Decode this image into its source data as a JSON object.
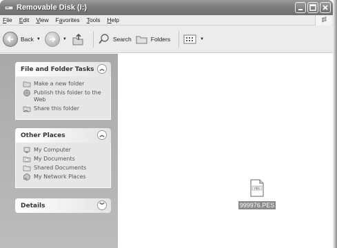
{
  "window": {
    "title": "Removable Disk (I:)"
  },
  "menu": {
    "items": [
      {
        "u": "F",
        "rest": "ile"
      },
      {
        "u": "E",
        "rest": "dit"
      },
      {
        "u": "V",
        "rest": "iew"
      },
      {
        "pre": "F",
        "u": "a",
        "rest": "vorites"
      },
      {
        "u": "T",
        "rest": "ools"
      },
      {
        "u": "H",
        "rest": "elp"
      }
    ]
  },
  "toolbar": {
    "back": "Back",
    "search": "Search",
    "folders": "Folders"
  },
  "sidepane": {
    "tasks": {
      "title": "File and Folder Tasks",
      "items": [
        "Make a new folder",
        "Publish this folder to the Web",
        "Share this folder"
      ]
    },
    "places": {
      "title": "Other Places",
      "items": [
        "My Computer",
        "My Documents",
        "Shared Documents",
        "My Network Places"
      ]
    },
    "details": {
      "title": "Details"
    }
  },
  "files": [
    {
      "name": "999976.PES",
      "icon_text": "PES"
    }
  ]
}
